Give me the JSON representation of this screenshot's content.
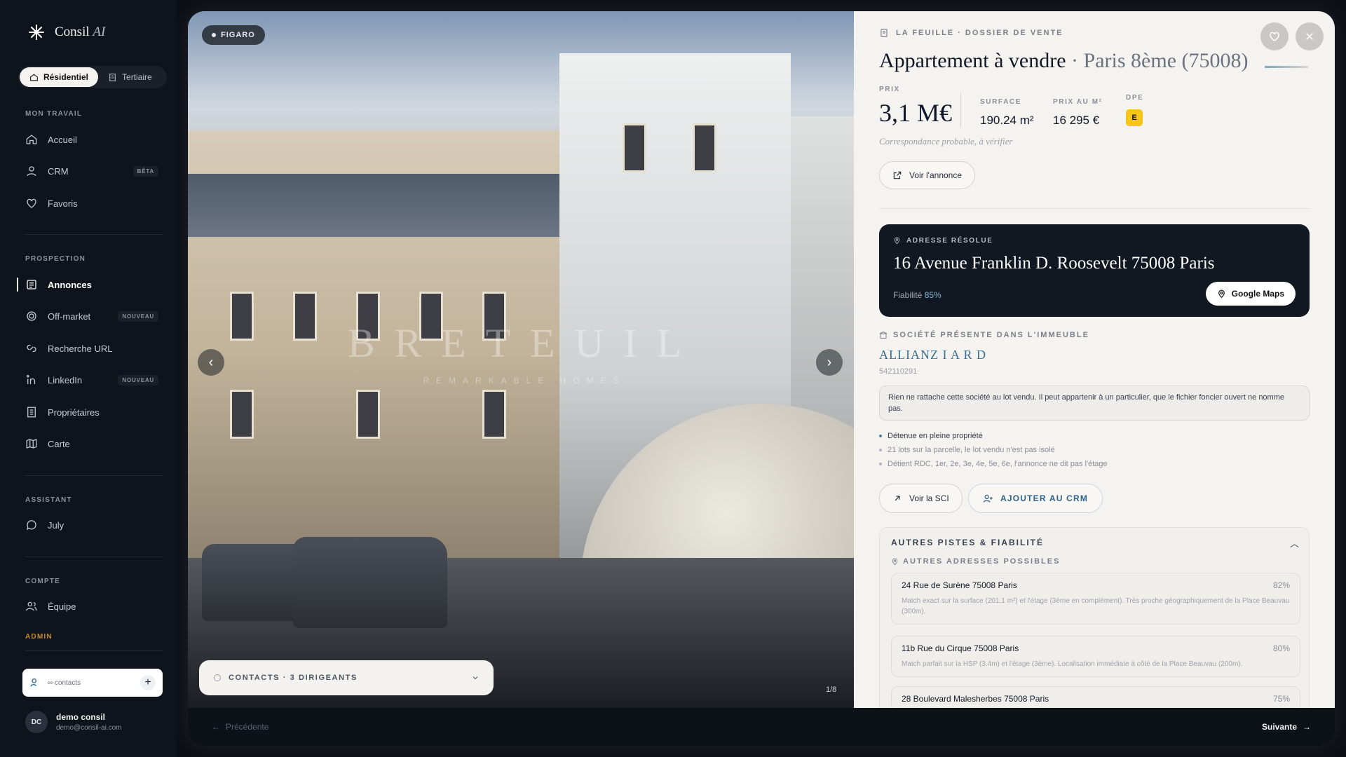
{
  "sidebar": {
    "brand": "Consil",
    "brand_suffix": "AI",
    "segment": [
      {
        "label": "Résidentiel",
        "active": true
      },
      {
        "label": "Tertiaire",
        "active": false
      }
    ],
    "sections": {
      "mon_travail": "MON TRAVAIL",
      "prospection": "PROSPECTION",
      "assistant": "ASSISTANT",
      "compte": "COMPTE",
      "admin": "ADMIN"
    },
    "items": {
      "accueil": "Accueil",
      "crm": "CRM",
      "crm_badge": "BÊTA",
      "favoris": "Favoris",
      "annonces": "Annonces",
      "offmarket": "Off-market",
      "offmarket_badge": "NOUVEAU",
      "recherche_url": "Recherche URL",
      "linkedin": "LinkedIn",
      "linkedin_badge": "NOUVEAU",
      "proprietaires": "Propriétaires",
      "carte": "Carte",
      "july": "July",
      "equipe": "Équipe"
    },
    "contacts_placeholder": "∞ contacts",
    "user": {
      "initials": "DC",
      "name": "demo consil",
      "email": "demo@consil-ai.com"
    }
  },
  "photo": {
    "source_badge": "FIGARO",
    "watermark": "BRETEUIL",
    "watermark_sub": "REMARKABLE HOMES",
    "counter": "1/8",
    "contacts_bar": "CONTACTS · 3 DIRIGEANTS"
  },
  "footer": {
    "prev": "Précédente",
    "next": "Suivante"
  },
  "panel": {
    "eyebrow": "LA FEUILLE · DOSSIER DE VENTE",
    "title_main": "Appartement à vendre",
    "title_sub": "· Paris 8ème (75008)",
    "price_label": "PRIX",
    "price": "3,1 M€",
    "surface_label": "SURFACE",
    "surface": "190.24 m²",
    "ppm_label": "PRIX AU M²",
    "ppm": "16 295 €",
    "dpe_label": "DPE",
    "dpe": "E",
    "note": "Correspondance probable, à vérifier",
    "voir_annonce": "Voir l'annonce",
    "address_card": {
      "eyebrow": "ADRESSE RÉSOLUE",
      "address": "16 Avenue Franklin D. Roosevelt 75008 Paris",
      "fiab_label": "Fiabilité",
      "fiab_value": "85%",
      "gmaps": "Google Maps"
    },
    "societe": {
      "eyebrow": "SOCIÉTÉ PRÉSENTE DANS L'IMMEUBLE",
      "name": "ALLIANZ I A R D",
      "siren": "542110291",
      "info": "Rien ne rattache cette société au lot vendu. Il peut appartenir à un particulier, que le fichier foncier ouvert ne nomme pas.",
      "bullets": [
        "Détenue en pleine propriété",
        "21 lots sur la parcelle, le lot vendu n'est pas isolé",
        "Détient RDC, 1er, 2e, 3e, 4e, 5e, 6e, l'annonce ne dit pas l'étage"
      ],
      "voir_sci": "Voir la SCI",
      "ajouter_crm": "AJOUTER AU CRM"
    },
    "pistes": {
      "head": "AUTRES PISTES & FIABILITÉ",
      "sub": "AUTRES ADRESSES POSSIBLES",
      "leads": [
        {
          "address": "24 Rue de Surène 75008 Paris",
          "pct": "82%",
          "desc": "Match exact sur la surface (201.1 m²) et l'étage (3ème en complément). Très proche géographiquement de la Place Beauvau (300m)."
        },
        {
          "address": "11b Rue du Cirque 75008 Paris",
          "pct": "80%",
          "desc": "Match parfait sur la HSP (3.4m) et l'étage (3ème). Localisation immédiate à côté de la Place Beauvau (200m)."
        },
        {
          "address": "28 Boulevard Malesherbes 75008 Paris",
          "pct": "75%",
          "desc": ""
        }
      ]
    }
  }
}
